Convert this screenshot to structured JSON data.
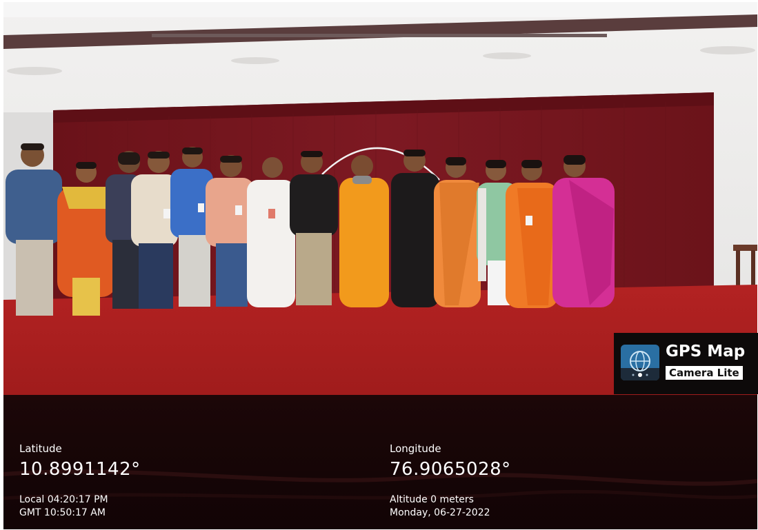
{
  "watermark": {
    "title": "GPS Map",
    "subtitle": "Camera Lite",
    "icon": "globe-camera-app-icon"
  },
  "location": {
    "latitude_label": "Latitude",
    "latitude_value": "10.8991142°",
    "longitude_label": "Longitude",
    "longitude_value": "76.9065028°",
    "local_time": "Local 04:20:17 PM",
    "gmt_time": "GMT 10:50:17 AM",
    "altitude": "Altitude 0 meters",
    "date": "Monday, 06-27-2022"
  },
  "colors": {
    "curtain": "#7a1720",
    "carpet": "#b52424",
    "wall": "#ecebea",
    "info_bg": "#1a0607"
  }
}
